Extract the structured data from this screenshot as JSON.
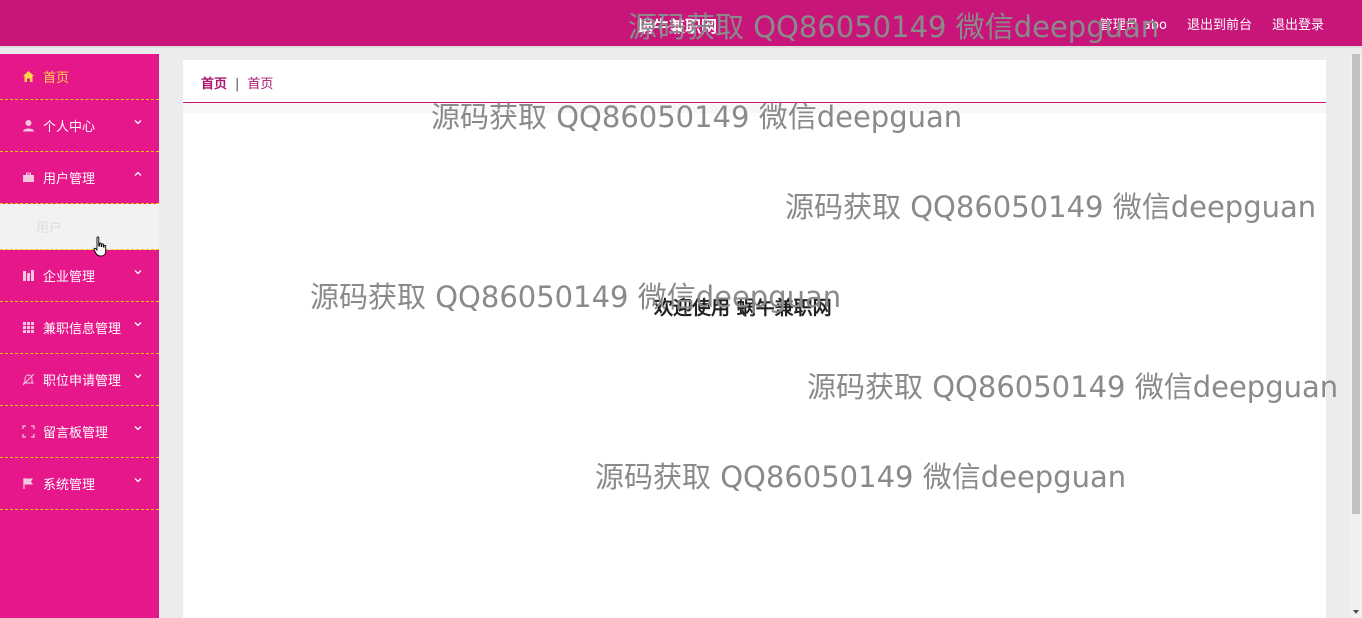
{
  "header": {
    "site_title": "蜗牛兼职网",
    "user_label": "管理员 abo",
    "back_to_front": "退出到前台",
    "logout": "退出登录"
  },
  "sidebar": {
    "items": [
      {
        "label": "首页",
        "icon": "home-icon",
        "active": true
      },
      {
        "label": "个人中心",
        "icon": "user-icon"
      },
      {
        "label": "用户管理",
        "icon": "briefcase-icon",
        "expanded": true,
        "children": [
          "用户"
        ]
      },
      {
        "label": "企业管理",
        "icon": "building-icon"
      },
      {
        "label": "兼职信息管理",
        "icon": "grid-icon"
      },
      {
        "label": "职位申请管理",
        "icon": "bell-icon"
      },
      {
        "label": "留言板管理",
        "icon": "frame-icon"
      },
      {
        "label": "系统管理",
        "icon": "flag-icon"
      }
    ]
  },
  "breadcrumb": {
    "home": "首页",
    "current": "首页"
  },
  "main": {
    "welcome": "欢迎使用 蜗牛兼职网"
  },
  "watermark": "源码获取 QQ86050149 微信deepguan",
  "colors": {
    "header_bg": "#c8157a",
    "sidebar_bg": "#e6178a",
    "active_text": "#ffd54a",
    "divider": "#f1c40f"
  }
}
